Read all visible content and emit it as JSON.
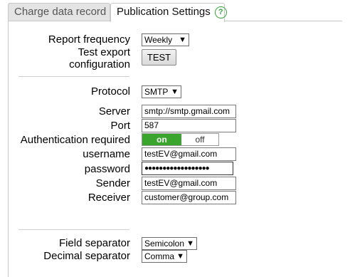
{
  "tabs": {
    "inactive_label": "Charge data record",
    "active_label": "Publication Settings",
    "help_glyph": "?"
  },
  "report": {
    "frequency_label": "Report frequency",
    "frequency_value": "Weekly",
    "test_label_line1": "Test export",
    "test_label_line2": "configuration",
    "test_button": "TEST"
  },
  "mail": {
    "protocol_label": "Protocol",
    "protocol_value": "SMTP",
    "server_label": "Server",
    "server_value": "smtp://smtp.gmail.com",
    "port_label": "Port",
    "port_value": "587",
    "auth_label": "Authentication required",
    "auth_on": "on",
    "auth_off": "off",
    "auth_state": "on",
    "username_label": "username",
    "username_value": "testEV@gmail.com",
    "password_label": "password",
    "password_value": "●●●●●●●●●●●●●●●●●●",
    "sender_label": "Sender",
    "sender_value": "testEV@gmail.com",
    "receiver_label": "Receiver",
    "receiver_value": "customer@group.com"
  },
  "format": {
    "field_sep_label": "Field separator",
    "field_sep_value": "Semicolon",
    "decimal_sep_label": "Decimal separator",
    "decimal_sep_value": "Comma"
  },
  "colors": {
    "toggle_on": "#3aa52c",
    "help_icon": "#3aa53a"
  }
}
